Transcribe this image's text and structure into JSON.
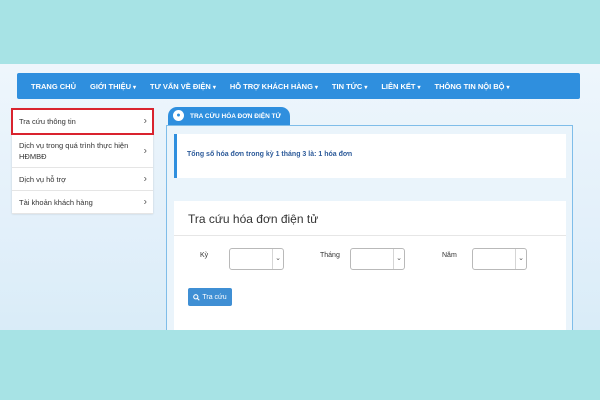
{
  "nav": {
    "items": [
      {
        "label": "TRANG CHỦ",
        "dropdown": false
      },
      {
        "label": "GIỚI THIỆU",
        "dropdown": true
      },
      {
        "label": "TƯ VẤN VỀ ĐIỆN",
        "dropdown": true
      },
      {
        "label": "HỖ TRỢ KHÁCH HÀNG",
        "dropdown": true
      },
      {
        "label": "TIN TỨC",
        "dropdown": true
      },
      {
        "label": "LIÊN KẾT",
        "dropdown": true
      },
      {
        "label": "THÔNG TIN NỘI BỘ",
        "dropdown": true
      }
    ]
  },
  "sidebar": {
    "items": [
      {
        "label": "Tra cứu thông tin",
        "active": true
      },
      {
        "label": "Dịch vụ trong quá trình thực hiện HĐMBĐ",
        "active": false
      },
      {
        "label": "Dịch vụ hỗ trợ",
        "active": false
      },
      {
        "label": "Tài khoản khách hàng",
        "active": false
      }
    ]
  },
  "tab": {
    "label": "TRA CỨU HÓA ĐƠN ĐIỆN TỬ"
  },
  "notice": {
    "text": "Tổng số hóa đơn trong kỳ 1 tháng 3 là: 1 hóa đơn"
  },
  "form": {
    "title": "Tra cứu hóa đơn điện tử",
    "ky_label": "Kỳ",
    "thang_label": "Tháng",
    "nam_label": "Năm",
    "ky_value": "",
    "thang_value": "",
    "nam_value": "",
    "button_label": "Tra cứu"
  },
  "colors": {
    "nav_bg": "#2f8fde",
    "highlight": "#d9232e",
    "notice_text": "#2d5b9a",
    "outer_bg": "#a7e3e5"
  }
}
